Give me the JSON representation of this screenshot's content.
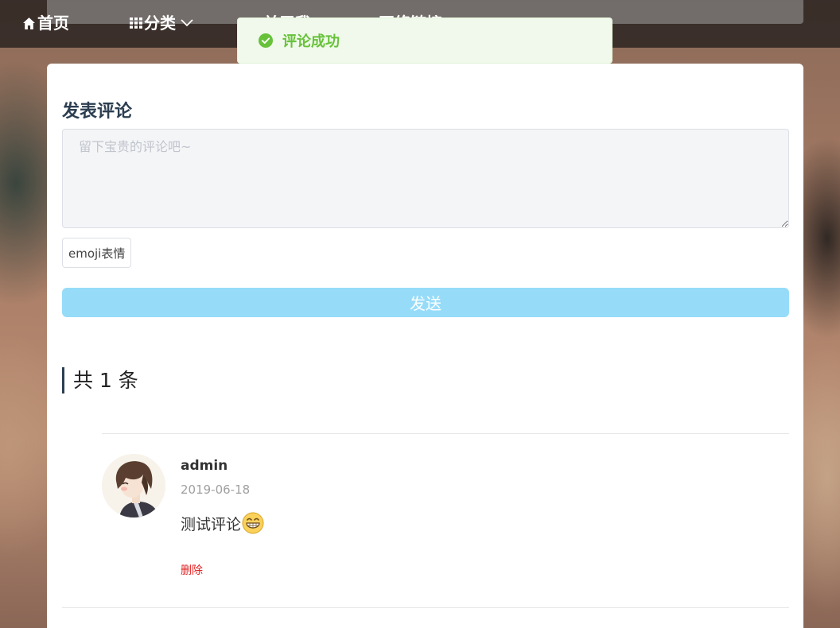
{
  "nav": {
    "home": "首页",
    "category": "分类",
    "about": "关于我",
    "links": "网络链接"
  },
  "toast": {
    "message": "评论成功"
  },
  "comment_form": {
    "title": "发表评论",
    "placeholder": "留下宝贵的评论吧~",
    "emoji_button": "emoji表情",
    "send_button": "发送"
  },
  "comments": {
    "count_label": "共 1 条",
    "items": [
      {
        "author": "admin",
        "date": "2019-06-18",
        "content": "测试评论",
        "delete_label": "删除"
      }
    ]
  },
  "colors": {
    "success": "#67c23a",
    "send_button": "#96dcf9",
    "delete": "#e02020"
  }
}
